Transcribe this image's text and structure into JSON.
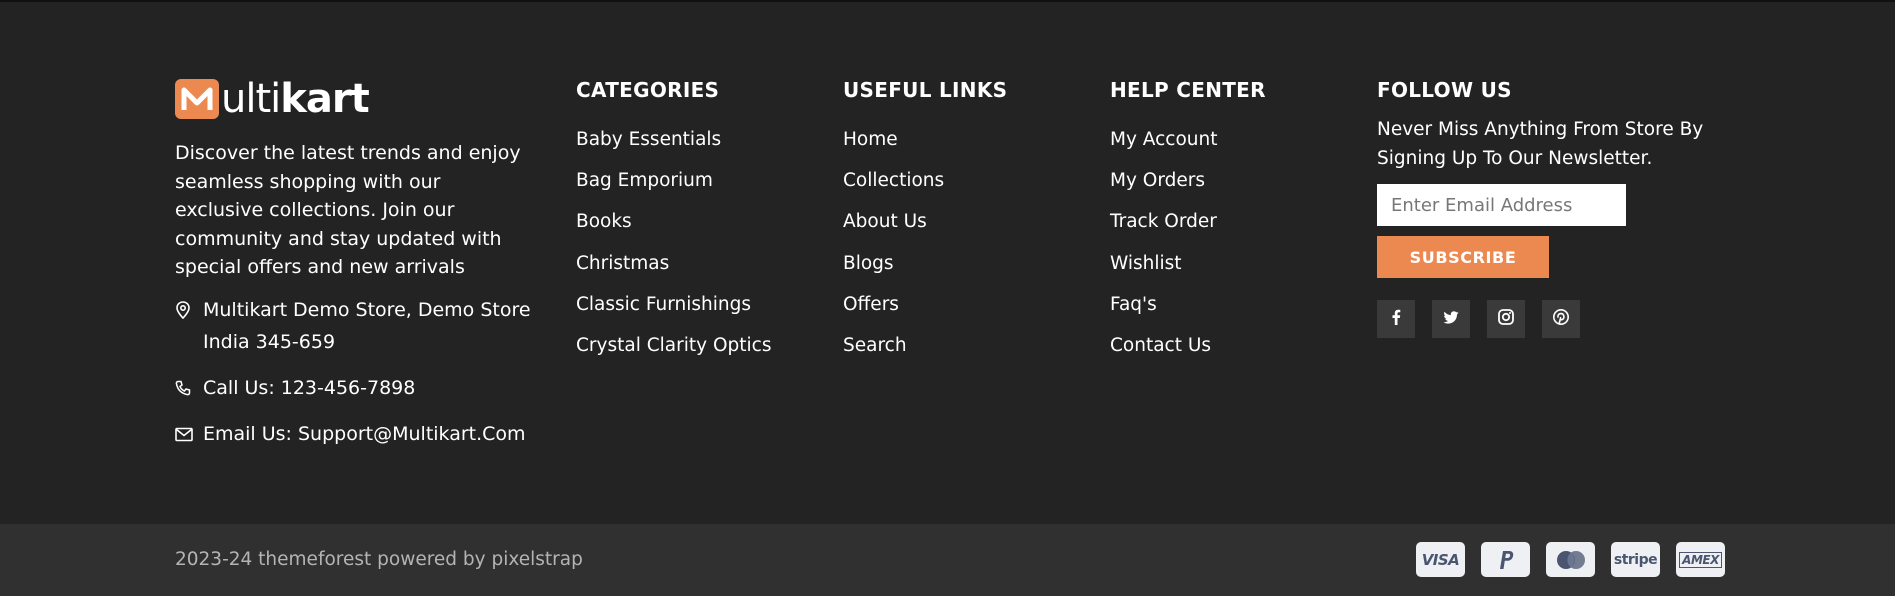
{
  "brand": {
    "logo_text_accent": "M",
    "logo_text_light": "ulti",
    "logo_text_bold": "kart",
    "about": "Discover the latest trends and enjoy seamless shopping with our exclusive collections. Join our community and stay updated with special offers and new arrivals",
    "address": "Multikart Demo Store, Demo Store India 345-659",
    "phone": "Call Us: 123-456-7898",
    "email": "Email Us: Support@Multikart.Com"
  },
  "categories": {
    "title": "CATEGORIES",
    "items": [
      "Baby Essentials",
      "Bag Emporium",
      "Books",
      "Christmas",
      "Classic Furnishings",
      "Crystal Clarity Optics"
    ]
  },
  "useful_links": {
    "title": "USEFUL LINKS",
    "items": [
      "Home",
      "Collections",
      "About Us",
      "Blogs",
      "Offers",
      "Search"
    ]
  },
  "help_center": {
    "title": "HELP CENTER",
    "items": [
      "My Account",
      "My Orders",
      "Track Order",
      "Wishlist",
      "Faq's",
      "Contact Us"
    ]
  },
  "follow": {
    "title": "FOLLOW US",
    "text": "Never Miss Anything From Store By Signing Up To Our Newsletter.",
    "email_placeholder": "Enter Email Address",
    "subscribe_label": "SUBSCRIBE",
    "social_icons": [
      "facebook-icon",
      "twitter-icon",
      "instagram-icon",
      "pinterest-icon"
    ]
  },
  "bottom": {
    "copyright": "2023-24 themeforest powered by pixelstrap",
    "payments": [
      "VISA",
      "PayPal",
      "Mastercard",
      "stripe",
      "AMEX"
    ]
  },
  "colors": {
    "accent": "#ec8951",
    "background": "#232323",
    "bottom_bar": "#303030"
  }
}
